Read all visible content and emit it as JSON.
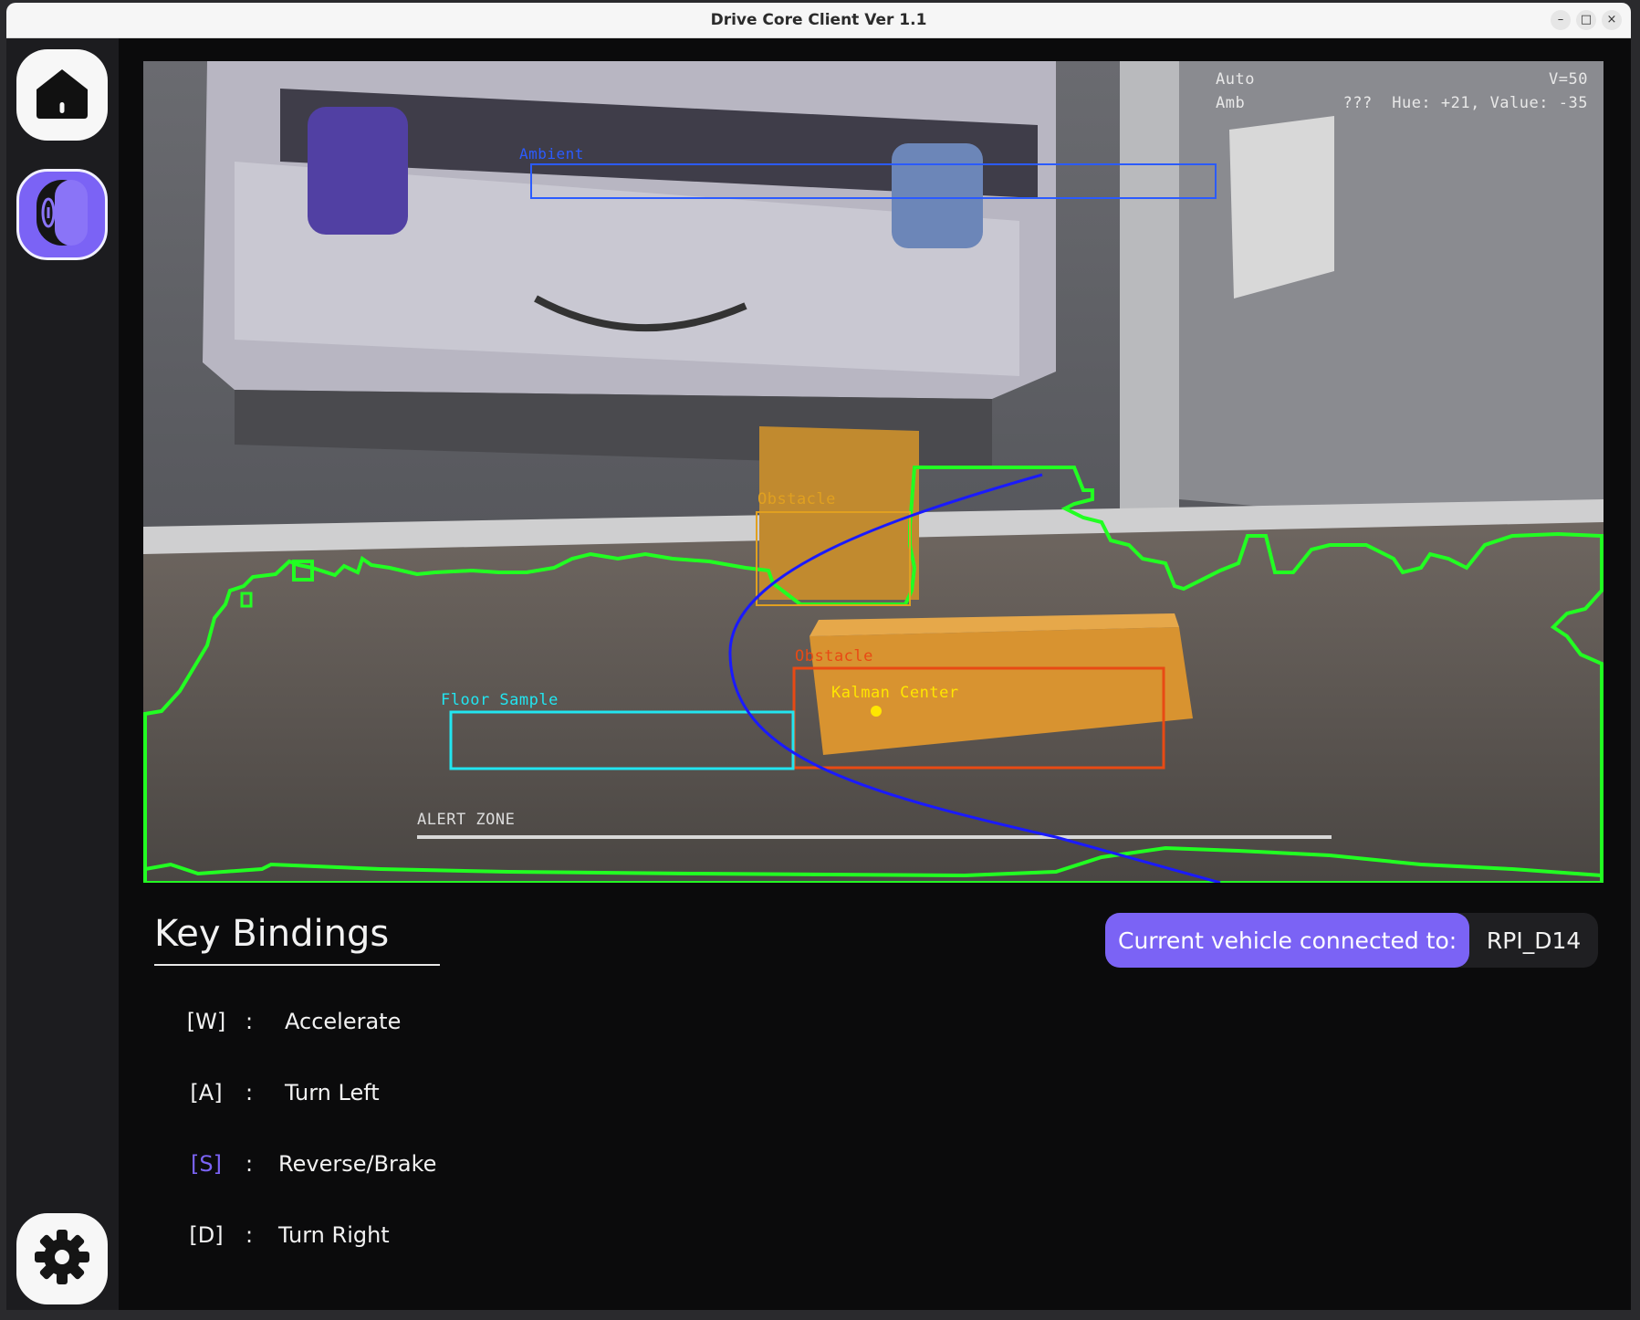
{
  "window": {
    "title": "Drive Core Client Ver 1.1",
    "minimize_glyph": "–",
    "maximize_glyph": "□",
    "close_glyph": "×"
  },
  "sidebar": {
    "items": [
      {
        "name": "home",
        "icon": "home-icon",
        "active": false
      },
      {
        "name": "drive",
        "icon": "drive-icon",
        "active": true
      },
      {
        "name": "settings",
        "icon": "gear-icon",
        "active": false
      }
    ]
  },
  "camera": {
    "hud_line1": "Auto                              V=50",
    "hud_line2": "Amb          ???  Hue: +21, Value: -35",
    "ambient_label": "Ambient",
    "obstacle_label_1": "Obstacle",
    "obstacle_label_2": "Obstacle",
    "kalman_label": "Kalman Center",
    "floor_sample_label": "Floor Sample",
    "alert_zone_label": "ALERT ZONE"
  },
  "key_bindings": {
    "title": "Key Bindings",
    "rows": [
      {
        "key": "[W]",
        "separator": ":",
        "action": "Accelerate",
        "active": false
      },
      {
        "key": "[A]",
        "separator": ":",
        "action": "Turn Left",
        "active": false
      },
      {
        "key": "[S]",
        "separator": ":",
        "action": "Reverse/Brake",
        "active": true
      },
      {
        "key": "[D]",
        "separator": ":",
        "action": "Turn Right",
        "active": false
      }
    ]
  },
  "connection": {
    "label": "Current vehicle connected to:",
    "value": "RPI_D14"
  },
  "colors": {
    "accent": "#7b63f5",
    "contour": "#22ff22",
    "trajectory": "#1a1aff",
    "floor_sample": "#22e5f0",
    "obstacle": "#e84a14",
    "ambient": "#2b5bff",
    "kalman": "#ffe600"
  }
}
